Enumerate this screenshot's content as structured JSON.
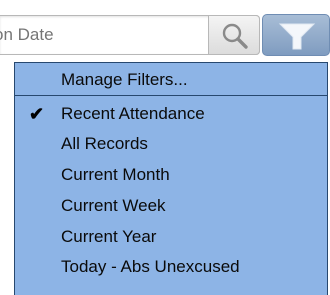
{
  "search": {
    "placeholder": "on Date"
  },
  "icons": {
    "search": "magnifier-icon",
    "filter": "funnel-icon"
  },
  "colors": {
    "menu_background": "#8db4e6",
    "menu_border": "#27486f",
    "filter_button": "#8fa9c9"
  },
  "menu": {
    "manage_label": "Manage Filters...",
    "check_glyph": "✔",
    "items": [
      {
        "label": "Recent Attendance",
        "checked": true
      },
      {
        "label": "All Records",
        "checked": false
      },
      {
        "label": "Current Month",
        "checked": false
      },
      {
        "label": "Current Week",
        "checked": false
      },
      {
        "label": "Current Year",
        "checked": false
      },
      {
        "label": "Today - Abs Unexcused",
        "checked": false
      }
    ]
  }
}
